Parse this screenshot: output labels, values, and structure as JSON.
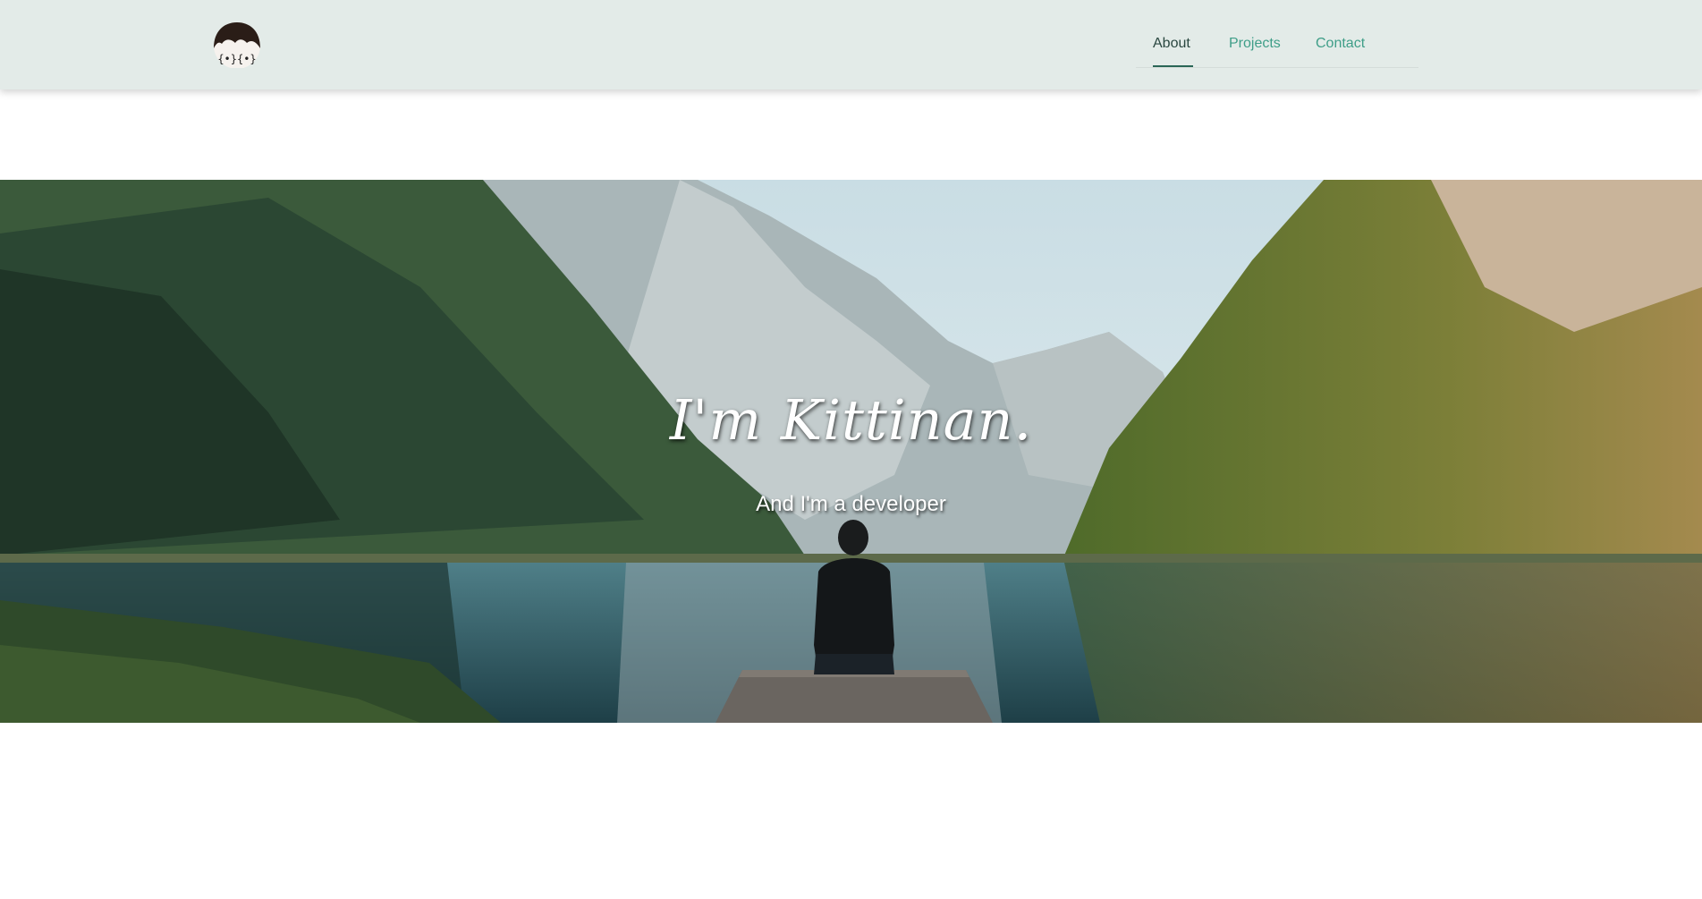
{
  "nav": {
    "logo_icon": "avatar-logo-icon",
    "items": [
      {
        "label": "About",
        "active": true
      },
      {
        "label": "Projects",
        "active": false
      },
      {
        "label": "Contact",
        "active": false
      }
    ]
  },
  "hero": {
    "title": "I'm Kittinan.",
    "subtitle": "And I'm a developer",
    "background": "mountain-lake-photo"
  },
  "colors": {
    "navbar_bg": "#e3ebe8",
    "link": "#3f9e88",
    "link_active": "#2a4740",
    "hero_text": "#ffffff"
  }
}
